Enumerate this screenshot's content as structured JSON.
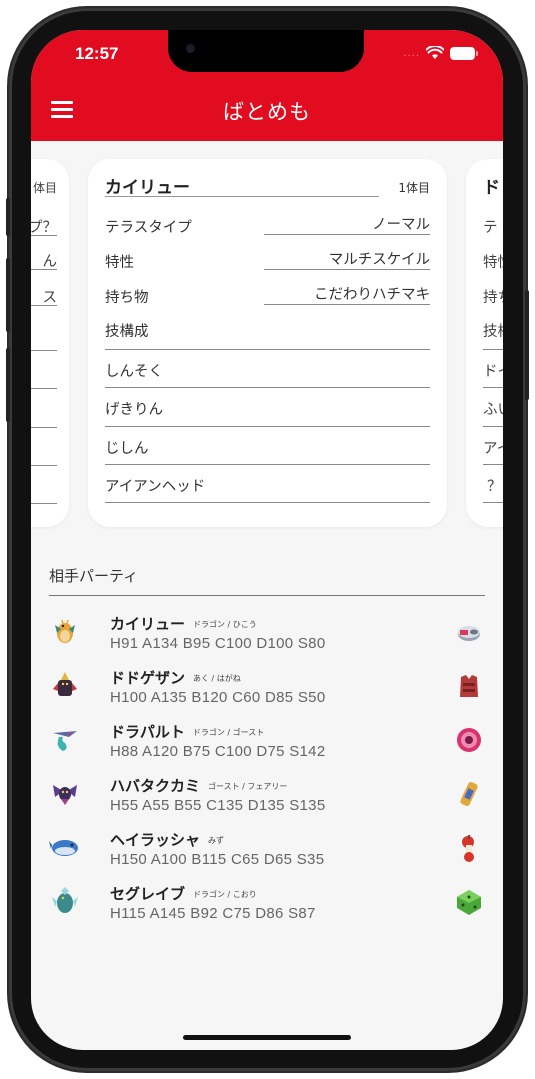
{
  "status": {
    "time": "12:57",
    "dots": "...."
  },
  "app": {
    "title": "ばとめも"
  },
  "left_card": {
    "idx": "体目",
    "tera_fragment": "プ？",
    "ability_fragment": "ん",
    "item_fragment": "ス"
  },
  "main_card": {
    "name": "カイリュー",
    "index": "1体目",
    "tera_label": "テラスタイプ",
    "tera_value": "ノーマル",
    "ability_label": "特性",
    "ability_value": "マルチスケイル",
    "item_label": "持ち物",
    "item_value": "こだわりハチマキ",
    "moves_label": "技構成",
    "moves": [
      "しんそく",
      "げきりん",
      "じしん",
      "アイアンヘッド"
    ]
  },
  "right_card": {
    "name_fragment": "ド",
    "tera_fragment": "テ",
    "ability_fragment": "特性",
    "item_fragment": "持ち",
    "moves_fragment": "技構",
    "move1_fragment": "ドイ",
    "move2_fragment": "ふい",
    "move3_fragment": "アイ",
    "move4_fragment": "？"
  },
  "opponent": {
    "title": "相手パーティ",
    "rows": [
      {
        "name": "カイリュー",
        "types": "ドラゴン / ひこう",
        "stats": "H91 A134 B95 C100 D100 S80",
        "sprite_icon": "dragonite-icon",
        "item_icon": "choice-band-icon"
      },
      {
        "name": "ドドゲザン",
        "types": "あく / はがね",
        "stats": "H100 A135 B120 C60 D85 S50",
        "sprite_icon": "kingambit-icon",
        "item_icon": "assault-vest-icon"
      },
      {
        "name": "ドラパルト",
        "types": "ドラゴン / ゴースト",
        "stats": "H88 A120 B75 C100 D75 S142",
        "sprite_icon": "dragapult-icon",
        "item_icon": "life-orb-icon"
      },
      {
        "name": "ハバタクカミ",
        "types": "ゴースト / フェアリー",
        "stats": "H55 A55 B55 C135 D135 S135",
        "sprite_icon": "flutter-mane-icon",
        "item_icon": "booster-energy-icon"
      },
      {
        "name": "ヘイラッシャ",
        "types": "みず",
        "stats": "H150 A100 B115 C65 D65 S35",
        "sprite_icon": "dondozo-icon",
        "item_icon": "leftovers-icon"
      },
      {
        "name": "セグレイブ",
        "types": "ドラゴン / こおり",
        "stats": "H115 A145 B92 C75 D86 S87",
        "sprite_icon": "baxcalibur-icon",
        "item_icon": "loaded-dice-icon"
      }
    ]
  },
  "colors": {
    "accent": "#e20c20",
    "background": "#f6f6f6",
    "card": "#ffffff"
  }
}
